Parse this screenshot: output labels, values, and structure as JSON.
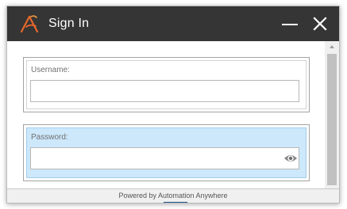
{
  "window": {
    "title": "Sign In"
  },
  "form": {
    "username": {
      "label": "Username:",
      "value": "",
      "placeholder": ""
    },
    "password": {
      "label": "Password:",
      "value": "",
      "placeholder": ""
    }
  },
  "footer": {
    "text": "Powered by Automation Anywhere"
  },
  "icons": {
    "logo": "automation-anywhere-logo",
    "minimize": "minimize-icon",
    "close": "close-icon",
    "show_password": "eye-icon",
    "scroll_up": "chevron-up-icon"
  },
  "colors": {
    "titlebar": "#353535",
    "logo_accent": "#e8672b",
    "focused_field": "#cde8fb"
  }
}
